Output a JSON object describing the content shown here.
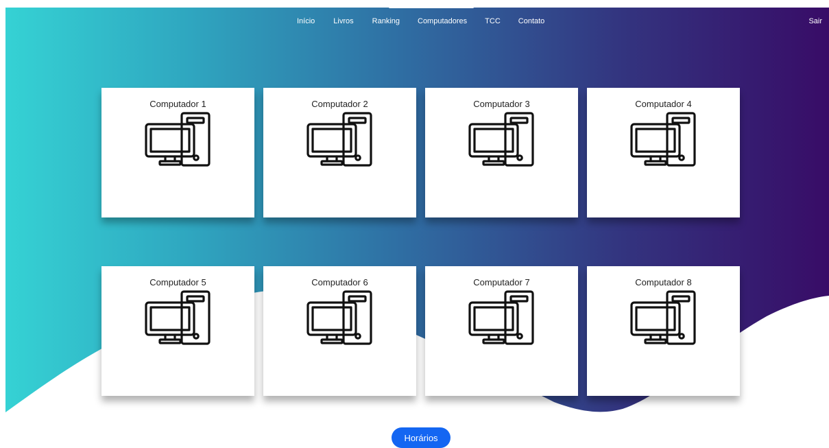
{
  "nav": {
    "links": [
      "Início",
      "Livros",
      "Ranking",
      "Computadores",
      "TCC",
      "Contato"
    ],
    "logout": "Sair"
  },
  "computers": [
    {
      "label": "Computador 1",
      "icon": "desktop-computer-icon"
    },
    {
      "label": "Computador 2",
      "icon": "desktop-computer-icon"
    },
    {
      "label": "Computador 3",
      "icon": "desktop-computer-icon"
    },
    {
      "label": "Computador 4",
      "icon": "desktop-computer-icon"
    },
    {
      "label": "Computador 5",
      "icon": "desktop-computer-icon"
    },
    {
      "label": "Computador 6",
      "icon": "desktop-computer-icon"
    },
    {
      "label": "Computador 7",
      "icon": "desktop-computer-icon"
    },
    {
      "label": "Computador 8",
      "icon": "desktop-computer-icon"
    }
  ],
  "schedule_button": "Horários",
  "colors": {
    "gradient_start": "#35d2d4",
    "gradient_end": "#380c67",
    "button": "#1466f2",
    "card": "#ffffff"
  }
}
